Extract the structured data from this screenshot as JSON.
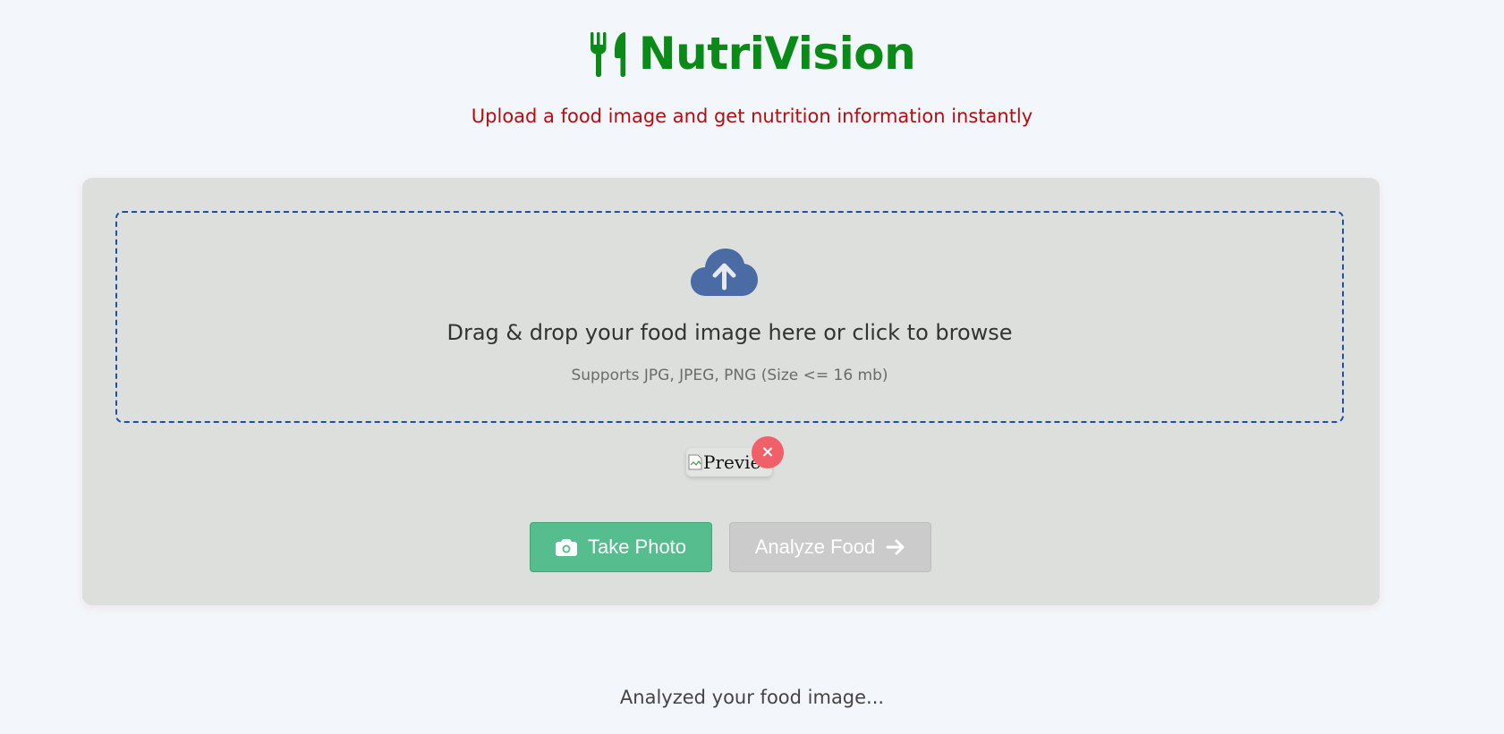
{
  "brand": {
    "name": "NutriVision",
    "logo_icon": "utensils-icon",
    "color": "#0a8a16"
  },
  "subtitle": "Upload a food image and get nutrition information instantly",
  "dropzone": {
    "icon": "cloud-upload-icon",
    "text": "Drag & drop your food image here or click to browse",
    "hint": "Supports JPG, JPEG, PNG (Size <= 16 mb)"
  },
  "preview": {
    "alt_text": "Previe",
    "remove_label": "×"
  },
  "buttons": {
    "take_photo": "Take Photo",
    "analyze": "Analyze Food"
  },
  "status_text": "Analyzed your food image..."
}
